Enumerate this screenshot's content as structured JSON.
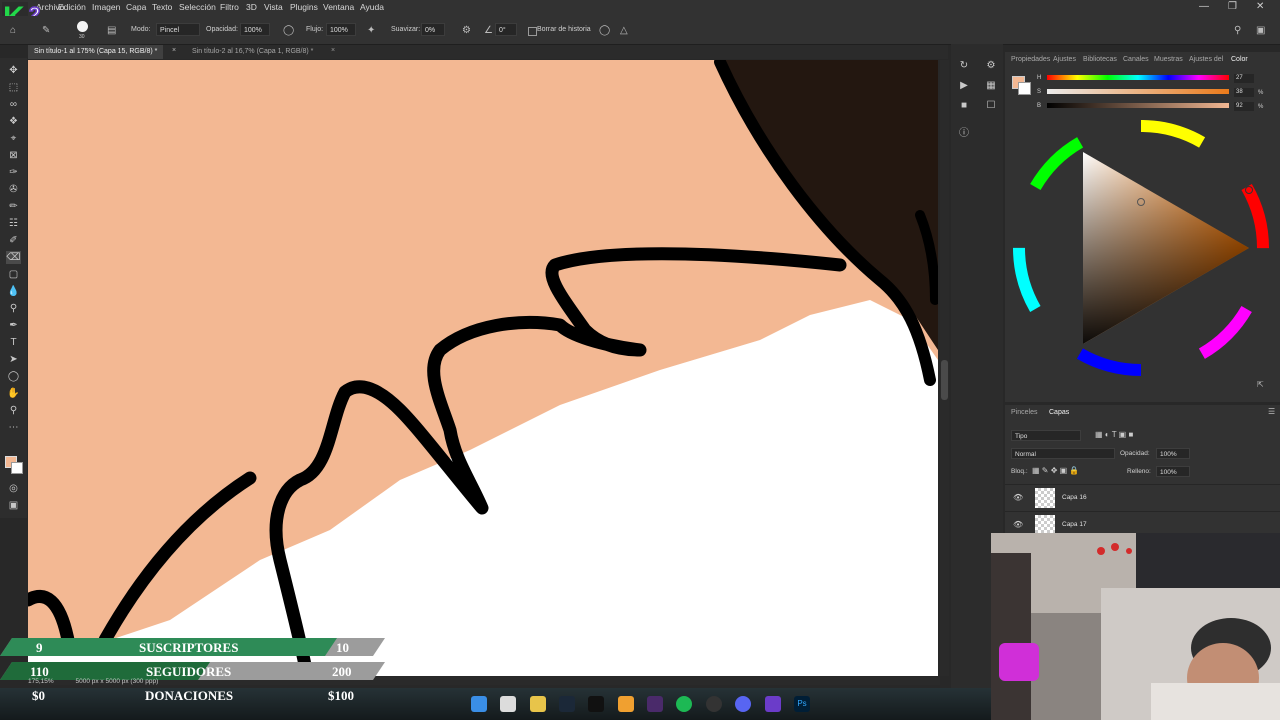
{
  "menu": {
    "items": [
      "Archivo",
      "Edición",
      "Imagen",
      "Capa",
      "Texto",
      "Selección",
      "Filtro",
      "3D",
      "Vista",
      "Plugins",
      "Ventana",
      "Ayuda"
    ]
  },
  "options_bar": {
    "modo_label": "Modo:",
    "modo_value": "Pincel",
    "opacidad_label": "Opacidad:",
    "opacidad_value": "100%",
    "flujo_label": "Flujo:",
    "flujo_value": "100%",
    "suavizar_label": "Suavizar:",
    "suavizar_value": "0%",
    "angle_value": "0°",
    "brush_size": "30",
    "borrar_historia_label": "Borrar de historia"
  },
  "tabs": [
    {
      "label": "Sin título-1 al 175% (Capa 15, RGB/8) *"
    },
    {
      "label": "Sin título-2 al 16,7% (Capa 1, RGB/8) *"
    }
  ],
  "status": {
    "zoom": "175,15%",
    "doc_info": "5000 px x 5000 px (300 ppp)"
  },
  "color_panel": {
    "tabs": [
      "Propiedades",
      "Ajustes",
      "Bibliotecas",
      "Canales",
      "Muestras",
      "Ajustes del",
      "Color"
    ],
    "h_label": "H",
    "h_value": "27",
    "s_label": "S",
    "s_value": "38",
    "s_unit": "%",
    "b_label": "B",
    "b_value": "92",
    "b_unit": "%",
    "foreground_color": "#f3b893"
  },
  "layers_panel": {
    "tabs": [
      "Pinceles",
      "Capas"
    ],
    "filter_value": "Tipo",
    "blend_mode": "Normal",
    "opacidad_label": "Opacidad:",
    "opacidad_value": "100%",
    "bloq_label": "Bloq.:",
    "relleno_label": "Relleno:",
    "relleno_value": "100%",
    "layers": [
      {
        "name": "Capa 16"
      },
      {
        "name": "Capa 17"
      }
    ]
  },
  "stream_overlay": {
    "suscriptores": {
      "current": "9",
      "label": "SUSCRIPTORES",
      "goal": "10"
    },
    "seguidores": {
      "current": "110",
      "label": "SEGUIDORES",
      "goal": "200"
    },
    "donaciones": {
      "current": "$0",
      "label": "DONACIONES",
      "goal": "$100"
    }
  },
  "logo_text": "K2",
  "colors": {
    "skin": "#f3b893",
    "hair": "#231710",
    "subs_bar": "#2e8b57",
    "follow_bar": "#1f6b3a",
    "photoshop_bg": "#323232"
  }
}
